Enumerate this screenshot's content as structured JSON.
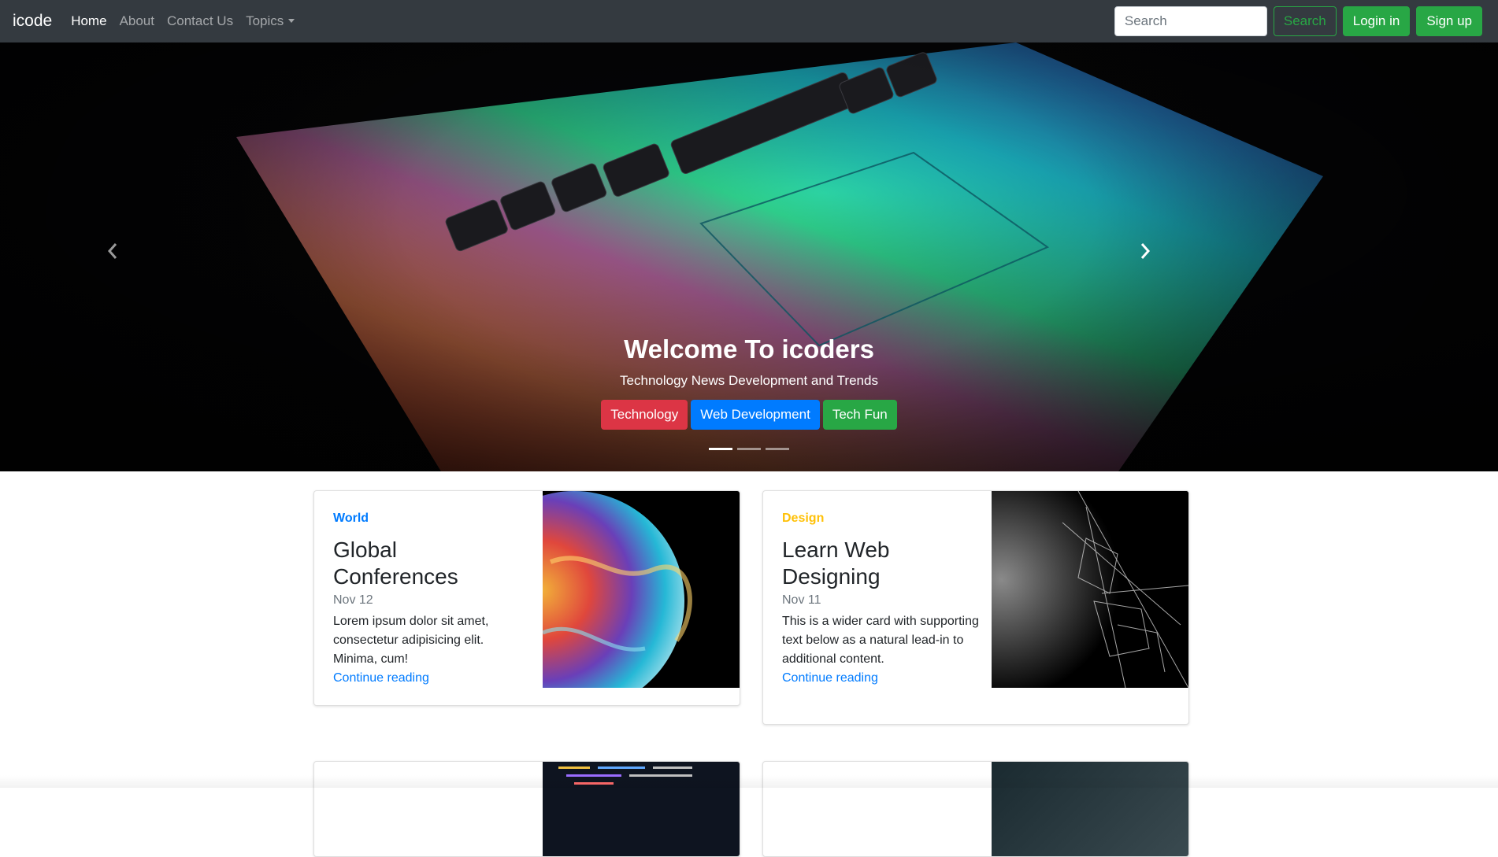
{
  "navbar": {
    "brand": "icode",
    "links": [
      "Home",
      "About",
      "Contact Us",
      "Topics"
    ],
    "search_placeholder": "Search",
    "search_button": "Search",
    "login_button": "Login in",
    "signup_button": "Sign up"
  },
  "hero": {
    "title": "Welcome To icoders",
    "subtitle": "Technology News Development and Trends",
    "buttons": [
      "Technology",
      "Web Development",
      "Tech Fun"
    ],
    "slide_count": 3,
    "active_slide": 1
  },
  "cards": [
    {
      "category": "World",
      "title_lines": [
        "Global",
        "Conferences"
      ],
      "date": "Nov 12",
      "text": "Lorem ipsum dolor sit amet, consectetur adipisicing elit. Minima, cum!",
      "link": "Continue reading",
      "image": "planet-bubble"
    },
    {
      "category": "Design",
      "title_lines": [
        "Learn Web",
        "Designing"
      ],
      "date": "Nov 11",
      "text": "This is a wider card with supporting text below as a natural lead-in to additional content.",
      "link": "Continue reading",
      "image": "spider-web"
    }
  ],
  "colors": {
    "navbar_bg": "#343a40",
    "success": "#28a745",
    "danger": "#dc3545",
    "primary": "#007bff",
    "warning": "#ffc107"
  }
}
